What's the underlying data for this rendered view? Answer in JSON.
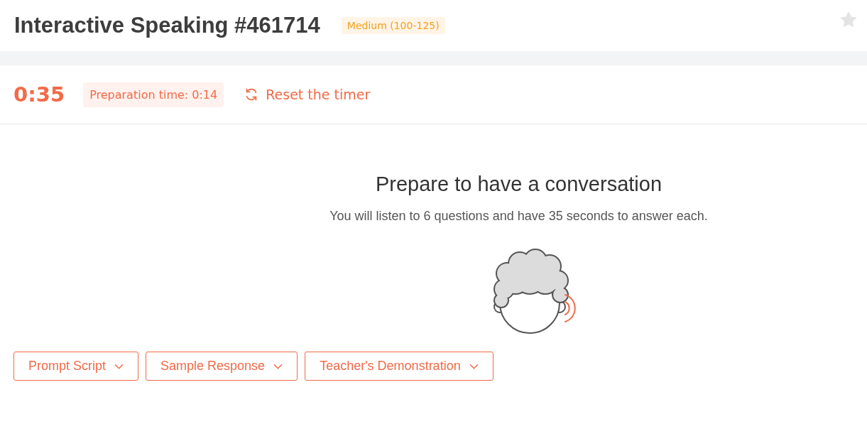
{
  "header": {
    "title": "Interactive Speaking #461714",
    "difficulty": "Medium (100-125)",
    "favorited": false
  },
  "timer": {
    "time": "0:35",
    "preparation": "Preparation time: 0:14",
    "reset": "Reset the timer"
  },
  "task": {
    "heading": "Prepare to have a conversation",
    "instructions": "You will listen to 6 questions and have 35 seconds to answer each.",
    "speaking": true
  },
  "buttons": [
    {
      "label": "Prompt Script",
      "expanded": false
    },
    {
      "label": "Sample Response",
      "expanded": false
    },
    {
      "label": "Teacher's Demonstration",
      "expanded": false
    }
  ]
}
